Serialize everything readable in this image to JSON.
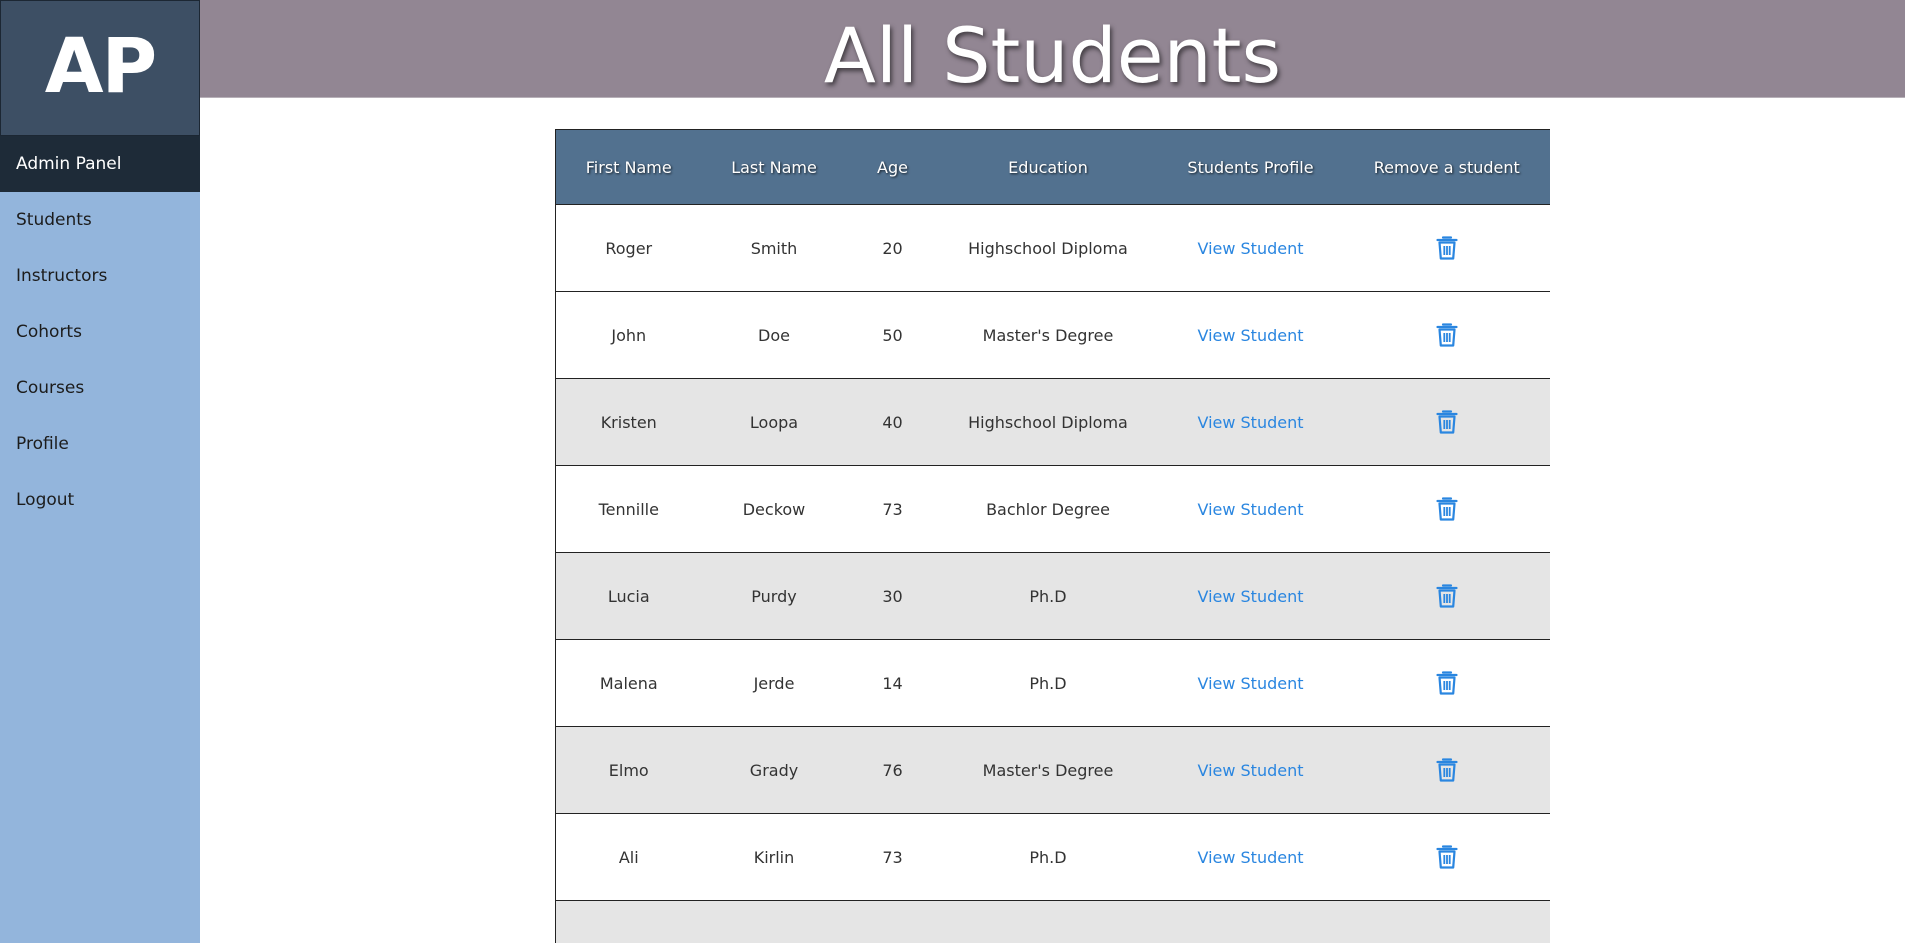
{
  "sidebar": {
    "logo": "AP",
    "items": [
      {
        "label": "Admin Panel",
        "active": true
      },
      {
        "label": "Students"
      },
      {
        "label": "Instructors"
      },
      {
        "label": "Cohorts"
      },
      {
        "label": "Courses"
      },
      {
        "label": "Profile"
      },
      {
        "label": "Logout"
      }
    ]
  },
  "header": {
    "title": "All Students"
  },
  "table": {
    "columns": [
      "First Name",
      "Last Name",
      "Age",
      "Education",
      "Students Profile",
      "Remove a student"
    ],
    "rows": [
      {
        "first": "Roger",
        "last": "Smith",
        "age": "20",
        "education": "Highschool Diploma",
        "profile": "View Student"
      },
      {
        "first": "John",
        "last": "Doe",
        "age": "50",
        "education": "Master's Degree",
        "profile": "View Student"
      },
      {
        "first": "Kristen",
        "last": "Loopa",
        "age": "40",
        "education": "Highschool Diploma",
        "profile": "View Student"
      },
      {
        "first": "Tennille",
        "last": "Deckow",
        "age": "73",
        "education": "Bachlor Degree",
        "profile": "View Student"
      },
      {
        "first": "Lucia",
        "last": "Purdy",
        "age": "30",
        "education": "Ph.D",
        "profile": "View Student"
      },
      {
        "first": "Malena",
        "last": "Jerde",
        "age": "14",
        "education": "Ph.D",
        "profile": "View Student"
      },
      {
        "first": "Elmo",
        "last": "Grady",
        "age": "76",
        "education": "Master's Degree",
        "profile": "View Student"
      },
      {
        "first": "Ali",
        "last": "Kirlin",
        "age": "73",
        "education": "Ph.D",
        "profile": "View Student"
      }
    ]
  },
  "colors": {
    "sidebar_bg": "#93b5dc",
    "sidebar_active": "#1e2b38",
    "logo_bg": "#3d4f64",
    "header_bg": "#928693",
    "table_header_bg": "#52718f",
    "row_alt_bg": "#e5e5e5",
    "link": "#2a86e0"
  },
  "icons": {
    "remove": "trash-icon"
  }
}
